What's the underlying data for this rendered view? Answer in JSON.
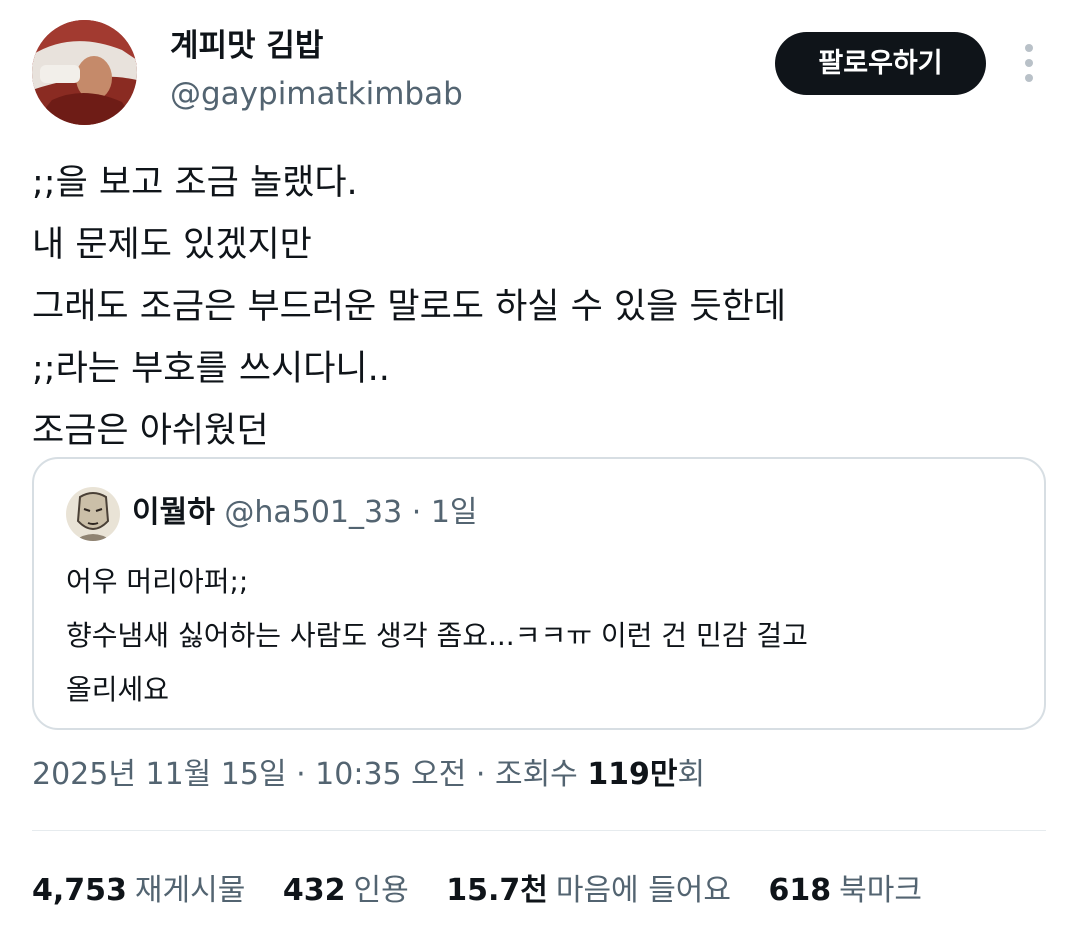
{
  "author": {
    "name": "계피맛 김밥",
    "handle": "@gaypimatkimbab",
    "follow_label": "팔로우하기"
  },
  "tweet": {
    "lines": [
      ";;을 보고 조금 놀랬다.",
      "내 문제도 있겠지만",
      "그래도 조금은 부드러운 말로도 하실 수 있을 듯한데",
      ";;라는 부호를 쓰시다니..",
      "조금은 아쉬웠던"
    ]
  },
  "quote": {
    "name": "이뭘하",
    "handle": "@ha501_33",
    "separator": "·",
    "time": "1일",
    "lines": [
      "어우 머리아퍼;;",
      "향수냄새 싫어하는 사람도 생각 좀요...ㅋㅋㅠ 이런 건 민감 걸고",
      "올리세요"
    ]
  },
  "meta": {
    "timestamp": "2025년 11월 15일 · 10:35 오전 · 조회수 ",
    "views_number": "119만",
    "views_suffix": "회"
  },
  "stats": {
    "retweets": {
      "num": "4,753",
      "label": "재게시물"
    },
    "quotes": {
      "num": "432",
      "label": "인용"
    },
    "likes": {
      "num": "15.7천",
      "label": "마음에 들어요"
    },
    "bookmarks": {
      "num": "618",
      "label": "북마크"
    }
  },
  "icons": {
    "more": "more-vertical-icon"
  },
  "colors": {
    "text_primary": "#0f1419",
    "text_secondary": "#536471",
    "border": "#d7dee3",
    "button_bg": "#0f1419"
  }
}
